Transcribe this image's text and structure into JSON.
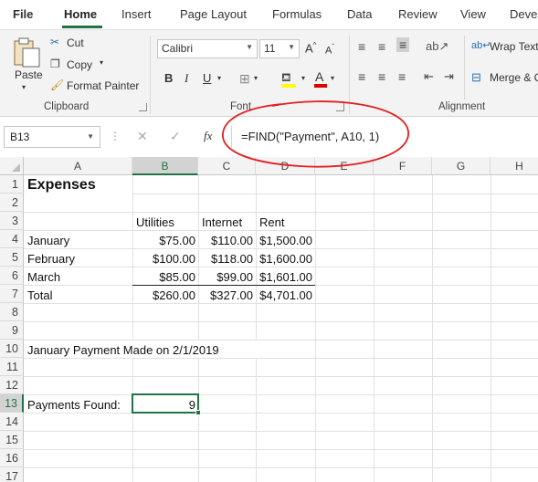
{
  "ribbon_tabs": [
    {
      "label": "File"
    },
    {
      "label": "Home"
    },
    {
      "label": "Insert"
    },
    {
      "label": "Page Layout"
    },
    {
      "label": "Formulas"
    },
    {
      "label": "Data"
    },
    {
      "label": "Review"
    },
    {
      "label": "View"
    },
    {
      "label": "Deve"
    }
  ],
  "active_tab": "Home",
  "clipboard": {
    "paste_label": "Paste",
    "cut_label": "Cut",
    "copy_label": "Copy",
    "format_painter_label": "Format Painter",
    "group_label": "Clipboard"
  },
  "font": {
    "font_name": "Calibri",
    "font_size": "11",
    "bold_label": "B",
    "italic_label": "I",
    "underline_label": "U",
    "grow_label": "A",
    "shrink_label": "A",
    "font_color_label": "A",
    "group_label": "Font"
  },
  "alignment": {
    "wrap_text_label": "Wrap Text",
    "merge_label": "Merge & C",
    "group_label": "Alignment"
  },
  "formula_bar": {
    "name_box": "B13",
    "fx_label": "fx",
    "formula": "=FIND(\"Payment\", A10, 1)"
  },
  "columns": [
    "A",
    "B",
    "C",
    "D",
    "E",
    "F",
    "G",
    "H"
  ],
  "selected_column": "B",
  "rows": [
    "1",
    "2",
    "3",
    "4",
    "5",
    "6",
    "7",
    "8",
    "9",
    "10",
    "11",
    "12",
    "13",
    "14",
    "15",
    "16",
    "17"
  ],
  "selected_row": "13",
  "cells": {
    "A1": "Expenses",
    "B3": "Utilities",
    "C3": "Internet",
    "D3": "Rent",
    "A4": "January",
    "B4": "$75.00",
    "C4": "$110.00",
    "D4": "$1,500.00",
    "A5": "February",
    "B5": "$100.00",
    "C5": "$118.00",
    "D5": "$1,600.00",
    "A6": "March",
    "B6": "$85.00",
    "C6": "$99.00",
    "D6": "$1,601.00",
    "A7": "Total",
    "B7": "$260.00",
    "C7": "$327.00",
    "D7": "$4,701.00",
    "A10": "January Payment Made on 2/1/2019",
    "A13": "Payments Found:",
    "B13": "9"
  },
  "colors": {
    "accent": "#217346",
    "annotation": "#e02020"
  }
}
